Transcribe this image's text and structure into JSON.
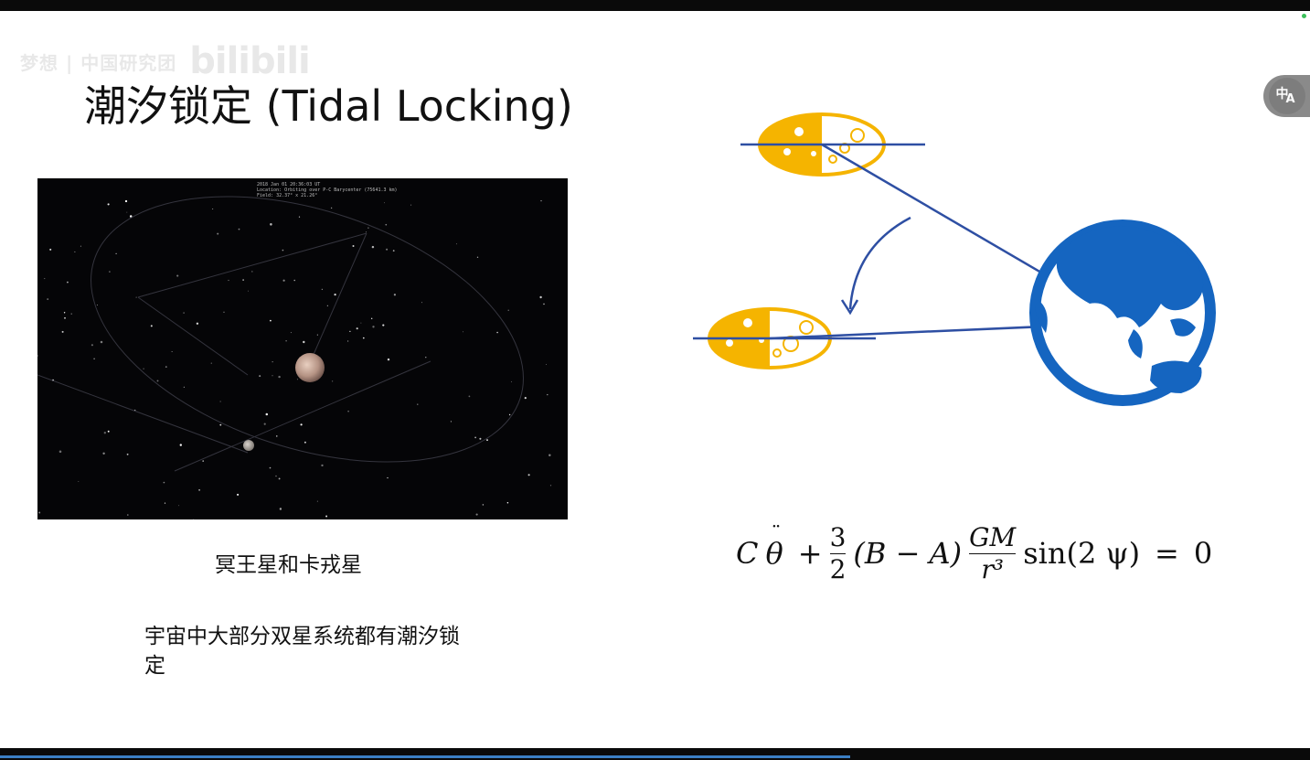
{
  "slide": {
    "title": "潮汐锁定 (Tidal Locking)",
    "watermark_text": "梦想 | 中国研究团",
    "watermark_logo": "bilibili",
    "image_caption": "冥王星和卡戎星",
    "body_text": "宇宙中大部分双星系统都有潮汐锁定",
    "screenshot_overlay_lines": [
      "2018 Jan 01 20:36:03 UT",
      "Location: Orbiting over P-C Barycenter (75641.3 km)",
      "Field: 32.37° x 21.26°"
    ]
  },
  "formula": {
    "C": "C",
    "theta": "θ",
    "theta_dots": "¨",
    "plus": "+",
    "frac1_num": "3",
    "frac1_den": "2",
    "paren_term": "(B − A)",
    "frac2_num": "GM",
    "frac2_den": "r³",
    "sin_term": "sin(2 ψ)",
    "equals": "=",
    "zero": "0"
  },
  "translate_button": {
    "glyph_1": "中",
    "glyph_2": "A"
  },
  "colors": {
    "moon_yellow": "#f5b400",
    "earth_blue": "#1565c0",
    "line_blue": "#2e4fa3",
    "starfield_bg": "#050507",
    "progress_blue": "#3b7fc4"
  },
  "icons": {
    "translate": "translate-icon",
    "moon": "moon-icon",
    "earth": "earth-globe-icon",
    "arrow": "curved-arrow-icon"
  }
}
